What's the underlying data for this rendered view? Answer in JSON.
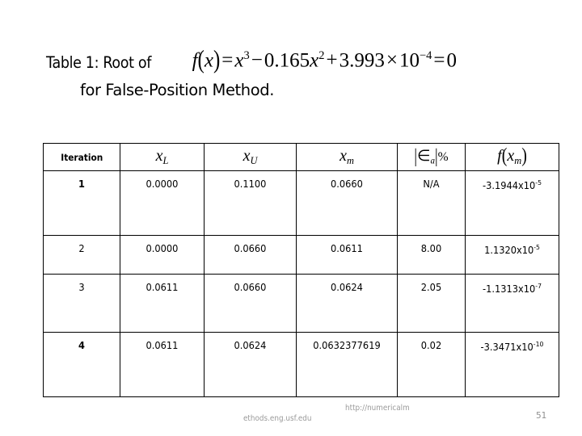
{
  "slide": {
    "title_prefix": "Table 1: Root of",
    "title_suffix": "for False-Position Method.",
    "equation": {
      "plain": "f(x) = x^3 - 0.165x^2 + 3.993x10^-4 = 0",
      "fn_name": "f",
      "fn_arg": "x",
      "equals": "=",
      "term1_base": "x",
      "term1_exp": "3",
      "minus": "−",
      "coef2": "0.165",
      "term2_base": "x",
      "term2_exp": "2",
      "plus": "+",
      "coef3": "3.993",
      "times": "×",
      "pow_base": "10",
      "pow_exp": "−4",
      "rhs_equals": "=",
      "rhs": "0"
    }
  },
  "table": {
    "headers": {
      "iteration": "Iteration",
      "xl_base": "x",
      "xl_sub": "L",
      "xu_base": "x",
      "xu_sub": "U",
      "xm_base": "x",
      "xm_sub": "m",
      "ea_bar_open": "|",
      "ea_symbol": "∈",
      "ea_sub": "a",
      "ea_bar_close": "|",
      "ea_percent": "%",
      "fxm_fn": "f",
      "fxm_arg_base": "x",
      "fxm_arg_sub": "m"
    },
    "rows": [
      {
        "iteration": "1",
        "xl": "0.0000",
        "xu": "0.1100",
        "xm": "0.0660",
        "ea": "N/A",
        "fxm_mantissa": "-3.1944x10",
        "fxm_exponent": "-5"
      },
      {
        "iteration": "2",
        "xl": "0.0000",
        "xu": "0.0660",
        "xm": "0.0611",
        "ea": "8.00",
        "fxm_mantissa": "1.1320x10",
        "fxm_exponent": "-5"
      },
      {
        "iteration": "3",
        "xl": "0.0611",
        "xu": "0.0660",
        "xm": "0.0624",
        "ea": "2.05",
        "fxm_mantissa": "-1.1313x10",
        "fxm_exponent": "-7"
      },
      {
        "iteration": "4",
        "xl": "0.0611",
        "xu": "0.0624",
        "xm": "0.0632377619",
        "ea": "0.02",
        "fxm_mantissa": "-3.3471x10",
        "fxm_exponent": "-10"
      }
    ]
  },
  "footer": {
    "url_part_1": "http://numericalm",
    "url_part_2": "ethods.eng.usf.edu",
    "page_number": "51"
  }
}
